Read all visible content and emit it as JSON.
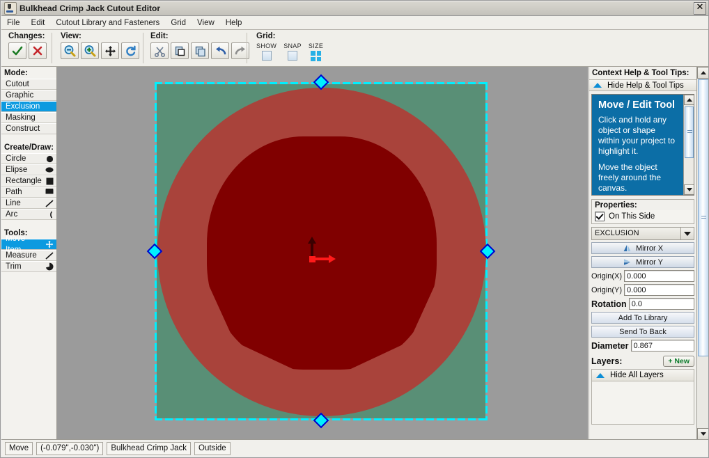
{
  "window": {
    "title": "Bulkhead Crimp Jack Cutout Editor",
    "app_icon": "java-coffee-cup-icon",
    "close_label": "✕"
  },
  "menubar": {
    "items": [
      {
        "label": "File",
        "mnemonic": "F"
      },
      {
        "label": "Edit",
        "mnemonic": "E"
      },
      {
        "label": "Cutout Library and Fasteners",
        "mnemonic": "C"
      },
      {
        "label": "Grid",
        "mnemonic": "d"
      },
      {
        "label": "View",
        "mnemonic": "e"
      },
      {
        "label": "Help",
        "mnemonic": "H"
      }
    ]
  },
  "toolbar": {
    "changes": {
      "label": "Changes:",
      "buttons": [
        {
          "name": "accept-changes-button",
          "icon": "check-icon",
          "color": "#1a7a22"
        },
        {
          "name": "reject-changes-button",
          "icon": "cross-icon",
          "color": "#c4262b"
        }
      ]
    },
    "view": {
      "label": "View:",
      "buttons": [
        {
          "name": "zoom-out-button",
          "icon": "zoom-out-icon"
        },
        {
          "name": "zoom-in-button",
          "icon": "zoom-in-icon"
        },
        {
          "name": "pan-button",
          "icon": "move-cross-icon"
        },
        {
          "name": "refresh-button",
          "icon": "refresh-icon"
        }
      ]
    },
    "edit": {
      "label": "Edit:",
      "buttons": [
        {
          "name": "cut-button",
          "icon": "scissors-icon"
        },
        {
          "name": "paste-button",
          "icon": "paste-icon"
        },
        {
          "name": "copy-button",
          "icon": "copy-icon"
        },
        {
          "name": "undo-button",
          "icon": "undo-arrow-icon"
        },
        {
          "name": "redo-button",
          "icon": "redo-arrow-icon"
        }
      ]
    },
    "grid": {
      "label": "Grid:",
      "show_label": "SHOW",
      "snap_label": "SNAP",
      "size_label": "SIZE",
      "show_checked": false,
      "snap_checked": false
    }
  },
  "sidebar": {
    "mode_header": "Mode:",
    "modes": [
      {
        "label": "Cutout",
        "selected": false
      },
      {
        "label": "Graphic",
        "selected": false
      },
      {
        "label": "Exclusion",
        "selected": true
      },
      {
        "label": "Masking",
        "selected": false
      },
      {
        "label": "Construct",
        "selected": false
      }
    ],
    "create_header": "Create/Draw:",
    "shapes": [
      {
        "label": "Circle",
        "icon": "circle-icon"
      },
      {
        "label": "Elipse",
        "icon": "ellipse-icon"
      },
      {
        "label": "Rectangle",
        "icon": "square-icon"
      },
      {
        "label": "Path",
        "icon": "path-icon"
      },
      {
        "label": "Line",
        "icon": "line-icon"
      },
      {
        "label": "Arc",
        "icon": "arc-icon"
      }
    ],
    "tools_header": "Tools:",
    "tools": [
      {
        "label": "Move Item",
        "icon": "move-cross-icon",
        "selected": true
      },
      {
        "label": "Measure",
        "icon": "ruler-icon",
        "selected": false
      },
      {
        "label": "Trim",
        "icon": "trim-icon",
        "selected": false
      }
    ]
  },
  "canvas": {
    "background_color": "#9b9b9b",
    "selection_fill_color": "#598f76",
    "outer_circle_color": "#a9433b",
    "inner_shape_color": "#800000",
    "selection_dash_color": "#00f0ff",
    "handle_border_color": "#0000cc",
    "gizmo_x_color": "#ff1a1a",
    "gizmo_y_color": "#3a0000",
    "handles": [
      "top-handle",
      "left-handle",
      "right-handle",
      "bottom-handle"
    ]
  },
  "help_panel": {
    "title": "Context Help & Tool Tips:",
    "toggle_label": "Hide Help & Tool Tips",
    "heading": "Move / Edit Tool",
    "paragraphs": [
      "Click and hold any object or shape within your project to highlight it.",
      "Move the object freely around the canvas."
    ],
    "background_color": "#0c6ea6"
  },
  "properties": {
    "title": "Properties:",
    "on_this_side_label": "On This Side",
    "on_this_side_checked": true,
    "type_value": "EXCLUSION",
    "mirror_x_label": "Mirror X",
    "mirror_y_label": "Mirror Y",
    "origin_x_label": "Origin(X)",
    "origin_x_value": "0.000",
    "origin_y_label": "Origin(Y)",
    "origin_y_value": "0.000",
    "rotation_label": "Rotation",
    "rotation_value": "0.0",
    "add_to_library_label": "Add To Library",
    "send_to_back_label": "Send To Back",
    "diameter_label": "Diameter",
    "diameter_value": "0.867"
  },
  "layers": {
    "title": "Layers:",
    "new_button_label": "+ New",
    "hide_all_label": "Hide All Layers"
  },
  "statusbar": {
    "cells": [
      "Move",
      "(-0.079\",-0.030\")",
      "Bulkhead Crimp Jack",
      "Outside"
    ]
  }
}
